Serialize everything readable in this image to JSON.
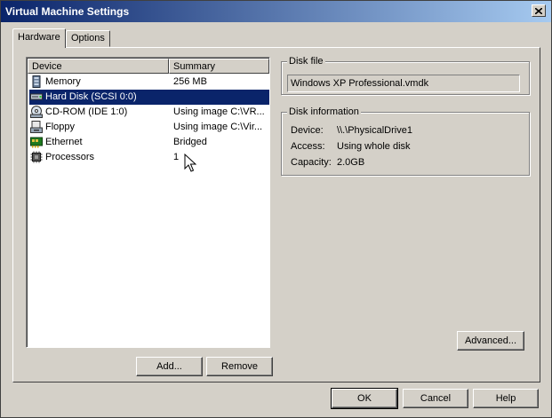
{
  "window": {
    "title": "Virtual Machine Settings"
  },
  "tabs": [
    {
      "label": "Hardware",
      "active": true
    },
    {
      "label": "Options",
      "active": false
    }
  ],
  "device_list": {
    "columns": [
      "Device",
      "Summary"
    ],
    "rows": [
      {
        "icon": "memory-icon",
        "device": "Memory",
        "summary": "256 MB",
        "selected": false
      },
      {
        "icon": "hard-disk-icon",
        "device": "Hard Disk (SCSI 0:0)",
        "summary": "",
        "selected": true
      },
      {
        "icon": "cdrom-icon",
        "device": "CD-ROM (IDE 1:0)",
        "summary": "Using image C:\\VR...",
        "selected": false
      },
      {
        "icon": "floppy-icon",
        "device": "Floppy",
        "summary": "Using image C:\\Vir...",
        "selected": false
      },
      {
        "icon": "ethernet-icon",
        "device": "Ethernet",
        "summary": "Bridged",
        "selected": false
      },
      {
        "icon": "processor-icon",
        "device": "Processors",
        "summary": "1",
        "selected": false
      }
    ]
  },
  "list_buttons": {
    "add": "Add...",
    "remove": "Remove"
  },
  "disk_file": {
    "legend": "Disk file",
    "value": "Windows XP Professional.vmdk"
  },
  "disk_info": {
    "legend": "Disk information",
    "device_label": "Device:",
    "device_value": "\\\\.\\PhysicalDrive1",
    "access_label": "Access:",
    "access_value": "Using whole disk",
    "capacity_label": "Capacity:",
    "capacity_value": "2.0GB"
  },
  "advanced_button": "Advanced...",
  "dialog_buttons": {
    "ok": "OK",
    "cancel": "Cancel",
    "help": "Help"
  },
  "colors": {
    "title_start": "#0a246a",
    "title_end": "#a6caf0",
    "selection": "#0a246a",
    "face": "#d4d0c8"
  }
}
